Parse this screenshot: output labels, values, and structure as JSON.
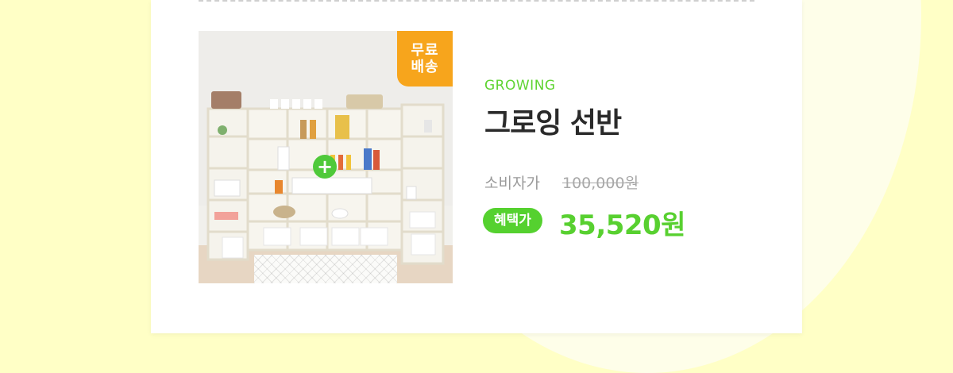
{
  "colors": {
    "page_background": "#ffffc6",
    "card_background": "#ffffff",
    "accent_green": "#55d12f",
    "badge_orange": "#f7a51c",
    "title_text": "#2a2a2a",
    "muted_text": "#9a9a9a"
  },
  "product": {
    "image_icon": "shelf-product-photo",
    "badge_label": "무료\n배송",
    "plus_icon": "plus-icon",
    "plus_label": "+",
    "brand": "GROWING",
    "name": "그로잉 선반",
    "retail_label": "소비자가",
    "retail_price": "100,000원",
    "benefit_label": "혜택가",
    "benefit_price": "35,520원"
  }
}
